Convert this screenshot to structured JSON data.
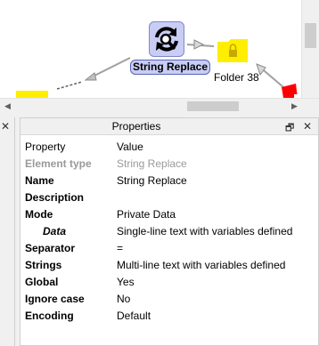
{
  "canvas": {
    "main_node_label": "String Replace",
    "folder_label": "Folder 38",
    "colors": {
      "node_fill": "#c9cdf5",
      "node_border": "#5a64b8",
      "folder_yellow": "#ffee00",
      "error_red": "#ff0000"
    }
  },
  "icons": {
    "main_node": "replace-arrows-magnifier-icon",
    "folder": "locked-folder-icon",
    "error": "red-flag-icon"
  },
  "left_panel": {
    "close_glyph": "✕"
  },
  "properties": {
    "title": "Properties",
    "restore_glyph": "🗗",
    "close_glyph": "✕",
    "header": {
      "key": "Property",
      "value": "Value"
    },
    "rows": [
      {
        "key": "Element type",
        "value": "String Replace"
      },
      {
        "key": "Name",
        "value": "String Replace"
      },
      {
        "key": "Description",
        "value": ""
      },
      {
        "key": "Mode",
        "value": "Private Data"
      },
      {
        "key": "Data",
        "value": "Single-line text with variables defined"
      },
      {
        "key": "Separator",
        "value": "="
      },
      {
        "key": "Strings",
        "value": "Multi-line text with variables defined"
      },
      {
        "key": "Global",
        "value": "Yes"
      },
      {
        "key": "Ignore case",
        "value": "No"
      },
      {
        "key": "Encoding",
        "value": "Default"
      }
    ]
  }
}
